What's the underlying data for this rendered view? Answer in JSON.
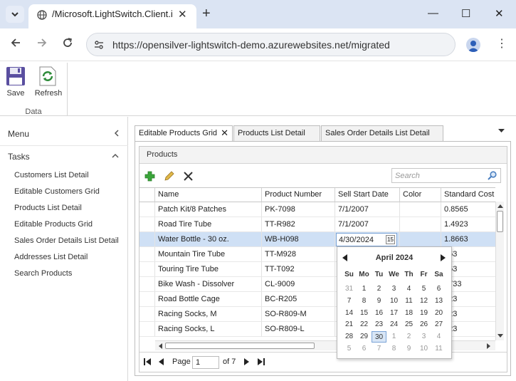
{
  "browser": {
    "tab_title": "/Microsoft.LightSwitch.Client.i",
    "url": "https://opensilver-lightswitch-demo.azurewebsites.net/migrated",
    "new_tab": "+",
    "close_tab": "✕",
    "minimize": "—",
    "maximize": "☐",
    "close": "✕"
  },
  "ribbon": {
    "save_label": "Save",
    "refresh_label": "Refresh",
    "group_label": "Data"
  },
  "nav": {
    "menu_label": "Menu",
    "tasks_label": "Tasks",
    "items": [
      "Customers List Detail",
      "Editable Customers Grid",
      "Products List Detail",
      "Editable Products Grid",
      "Sales Order Details List Detail",
      "Addresses List Detail",
      "Search Products"
    ]
  },
  "tabs": [
    {
      "label": "Editable Products Grid",
      "active": true
    },
    {
      "label": "Products List Detail",
      "active": false
    },
    {
      "label": "Sales Order Details List Detail",
      "active": false
    }
  ],
  "grid": {
    "title": "Products",
    "search_placeholder": "Search",
    "columns": [
      "Name",
      "Product Number",
      "Sell Start Date",
      "Color",
      "Standard Cost"
    ],
    "rows": [
      {
        "name": "Patch Kit/8 Patches",
        "number": "PK-7098",
        "date": "7/1/2007",
        "color": "",
        "cost": "0.8565"
      },
      {
        "name": "Road Tire Tube",
        "number": "TT-R982",
        "date": "7/1/2007",
        "color": "",
        "cost": "1.4923"
      },
      {
        "name": "Water Bottle - 30 oz.",
        "number": "WB-H098",
        "date": "4/30/2024",
        "color": "",
        "cost": "1.8663"
      },
      {
        "name": "Mountain Tire Tube",
        "number": "TT-M928",
        "date": "",
        "color": "",
        "cost": "663"
      },
      {
        "name": "Touring Tire Tube",
        "number": "TT-T092",
        "date": "",
        "color": "",
        "cost": "663"
      },
      {
        "name": "Bike Wash - Dissolver",
        "number": "CL-9009",
        "date": "",
        "color": "",
        "cost": "9733"
      },
      {
        "name": "Road Bottle Cage",
        "number": "BC-R205",
        "date": "",
        "color": "",
        "cost": "623"
      },
      {
        "name": "Racing Socks, M",
        "number": "SO-R809-M",
        "date": "",
        "color": "",
        "cost": "623"
      },
      {
        "name": "Racing Socks, L",
        "number": "SO-R809-L",
        "date": "",
        "color": "",
        "cost": "623"
      }
    ],
    "selected_row": 2
  },
  "pager": {
    "page_label": "Page",
    "page_value": "1",
    "of_label": "of 7"
  },
  "calendar": {
    "month_label": "April 2024",
    "day_names": [
      "Su",
      "Mo",
      "Tu",
      "We",
      "Th",
      "Fr",
      "Sa"
    ],
    "weeks": [
      [
        "31",
        "1",
        "2",
        "3",
        "4",
        "5",
        "6"
      ],
      [
        "7",
        "8",
        "9",
        "10",
        "11",
        "12",
        "13"
      ],
      [
        "14",
        "15",
        "16",
        "17",
        "18",
        "19",
        "20"
      ],
      [
        "21",
        "22",
        "23",
        "24",
        "25",
        "26",
        "27"
      ],
      [
        "28",
        "29",
        "30",
        "1",
        "2",
        "3",
        "4"
      ],
      [
        "5",
        "6",
        "7",
        "8",
        "9",
        "10",
        "11"
      ]
    ],
    "selected_day": "30"
  },
  "colors": {
    "selection": "#cfe0f5",
    "add_icon": "#3aa53a",
    "edit_icon": "#c79a2a",
    "refresh_icon": "#2e8b3a",
    "save_icon": "#5a4fa0"
  }
}
